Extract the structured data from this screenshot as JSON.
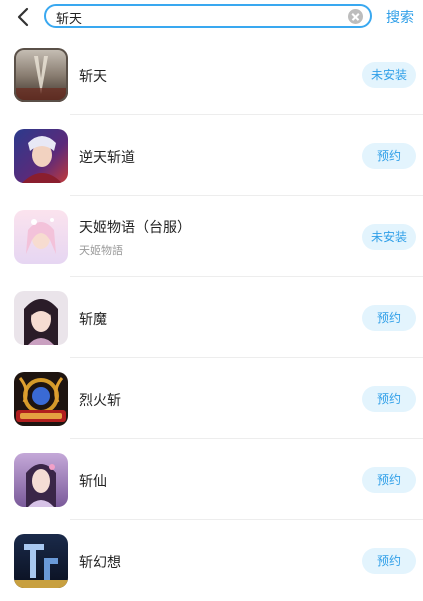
{
  "search": {
    "back_icon": "chevron-left-icon",
    "query": "斩天",
    "clear_icon": "clear-circle-icon",
    "submit_label": "搜索"
  },
  "colors": {
    "accent": "#2f9fe8",
    "search_border": "#39a8f0",
    "button_bg": "#e3f4fd",
    "divider": "#ededed"
  },
  "results": [
    {
      "name": "斩天",
      "subtitle": "",
      "action": "未安装"
    },
    {
      "name": "逆天斩道",
      "subtitle": "",
      "action": "预约"
    },
    {
      "name": "天姬物语（台服）",
      "subtitle": "天姬物語",
      "action": "未安装"
    },
    {
      "name": "斩魔",
      "subtitle": "",
      "action": "预约"
    },
    {
      "name": "烈火斩",
      "subtitle": "",
      "action": "预约"
    },
    {
      "name": "斩仙",
      "subtitle": "",
      "action": "预约"
    },
    {
      "name": "斩幻想",
      "subtitle": "",
      "action": "预约"
    }
  ]
}
